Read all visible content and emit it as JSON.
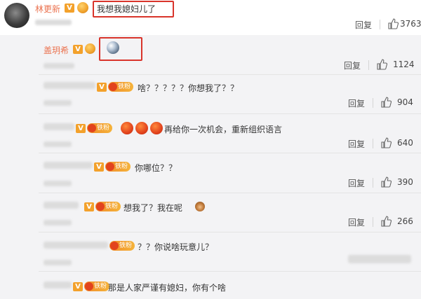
{
  "actions": {
    "reply_label": "回复"
  },
  "main_comment": {
    "username": "林更新",
    "text": "我想我媳妇儿了",
    "likes": "3763"
  },
  "reply_thread": [
    {
      "username": "盖玥希",
      "text": "",
      "likes": "1124"
    },
    {
      "username": "",
      "fan_label": "铁粉",
      "text": "啥？？？？？你想我了？？",
      "likes": "904"
    },
    {
      "username": "",
      "fan_label": "铁粉",
      "text": "再给你一次机会，重新组织语言",
      "likes": "640"
    },
    {
      "username": "",
      "fan_label": "铁粉",
      "text": "你哪位？？",
      "likes": "390"
    },
    {
      "username": "",
      "fan_label": "铁粉",
      "text": "想我了？我在呢",
      "likes": "266"
    },
    {
      "username": "",
      "fan_label": "铁粉",
      "text": "？？你说啥玩意儿？",
      "likes": ""
    },
    {
      "username": "",
      "fan_label": "铁粉",
      "text": "那是人家严谨有媳妇，你有个啥",
      "likes": ""
    }
  ],
  "colors": {
    "accent": "#eb7350",
    "highlight_box": "#d9342b",
    "background": "#f3f3f5"
  },
  "icons": [
    "like-icon",
    "v-badge-icon",
    "fan-badge-icon",
    "earth-emoji-icon",
    "angry-face-emoji-icon",
    "monkey-emoji-icon"
  ]
}
